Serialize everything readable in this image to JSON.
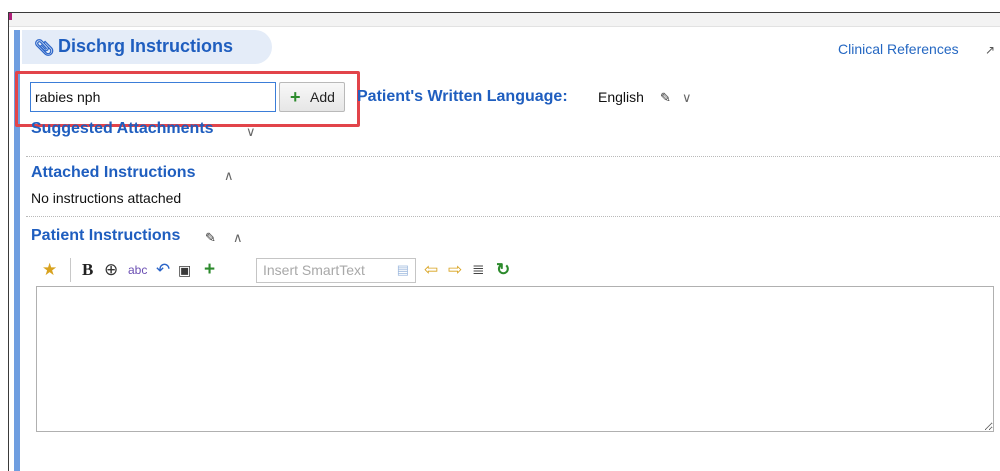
{
  "section": {
    "title": "Dischrg Instructions",
    "clip_icon": "paperclip-icon",
    "clinical_references": "Clinical References"
  },
  "search": {
    "value": "rabies nph",
    "add_label": "Add"
  },
  "language": {
    "label": "Patient's Written Language:",
    "value": "English"
  },
  "suggested": {
    "title": "Suggested Attachments"
  },
  "attached": {
    "title": "Attached Instructions",
    "empty_text": "No instructions attached"
  },
  "patient_instructions": {
    "title": "Patient Instructions",
    "smarttext_placeholder": "Insert SmartText",
    "editor_value": ""
  },
  "colors": {
    "accent": "#1f5ebf",
    "highlight": "#e2444a",
    "left_bar": "#6f9ee0",
    "add_plus": "#2c8a2c"
  }
}
